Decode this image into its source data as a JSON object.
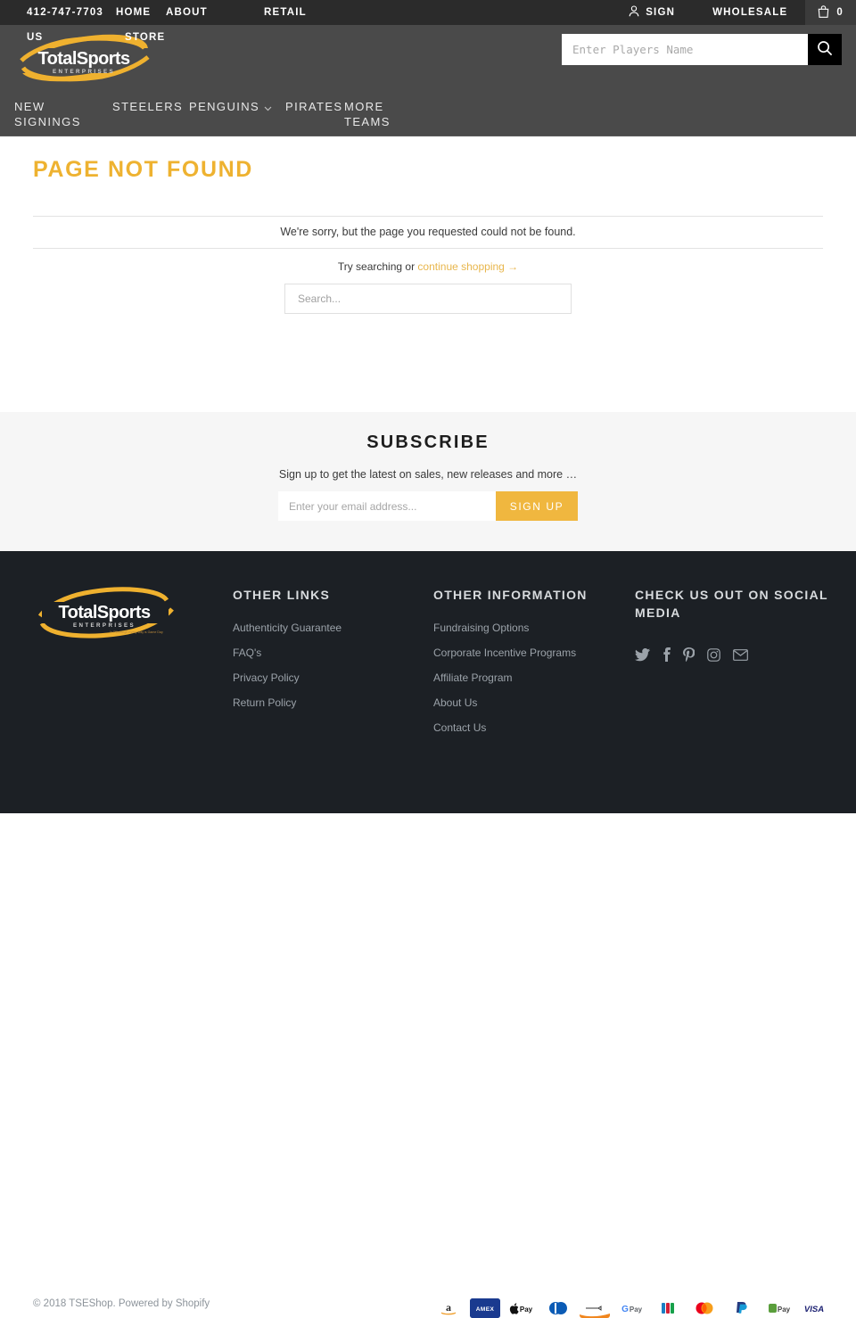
{
  "topbar": {
    "phone": "412-747-7703",
    "home": "HOME",
    "about": "ABOUT",
    "about2": "US",
    "retail": "RETAIL",
    "retail2": "STORE",
    "sign": "SIGN",
    "wholesale": "WHOLESALE",
    "cart_count": "0",
    "icons": {
      "person": "person-icon",
      "bag": "shopping-bag-icon"
    },
    "bg": "#2b2b2b"
  },
  "header": {
    "logo_main": "TotalSports",
    "logo_sub": "E N T E R P R I S E S",
    "search_placeholder": "Enter Players Name",
    "search_value": "",
    "search_icon": "search-icon",
    "bg": "#4a4a4a",
    "accent": "#eeb230"
  },
  "mainnav": {
    "items": [
      {
        "label": "NEW SIGNINGS",
        "has_chevron": false
      },
      {
        "label": "STEELERS",
        "has_chevron": false
      },
      {
        "label": "PENGUINS",
        "has_chevron": true
      },
      {
        "label": "PIRATES",
        "has_chevron": false
      },
      {
        "label": "MORE TEAMS",
        "has_chevron": false
      }
    ]
  },
  "main": {
    "title": "PAGE NOT FOUND",
    "message": "We're sorry, but the page you requested could not be found.",
    "try_text": "Try searching or ",
    "continue_link": "continue shopping →",
    "search_placeholder": "Search...",
    "search_value": "",
    "title_color": "#eeb230"
  },
  "subscribe": {
    "title": "SUBSCRIBE",
    "subtitle": "Sign up to get the latest on sales, new releases and more …",
    "email_placeholder": "Enter your email address...",
    "email_value": "",
    "button_label": "SIGN UP",
    "button_color": "#f0b73f",
    "bg": "#f6f6f6"
  },
  "footer": {
    "bg": "#1c2025",
    "logo_main": "TotalSports",
    "logo_sub": "E N T E R P R I S E S",
    "logo_tag": "In Pittsburgh Every Day is Game Day",
    "col1": {
      "heading": "OTHER LINKS",
      "links": [
        "Authenticity Guarantee",
        "FAQ's",
        "Privacy Policy",
        "Return Policy"
      ]
    },
    "col2": {
      "heading": "OTHER INFORMATION",
      "links": [
        "Fundraising Options",
        "Corporate Incentive Programs",
        "Affiliate Program",
        "About Us",
        "Contact Us"
      ]
    },
    "col3": {
      "heading": "CHECK US OUT ON SOCIAL MEDIA",
      "social": [
        "twitter-icon",
        "facebook-icon",
        "pinterest-icon",
        "instagram-icon",
        "email-icon"
      ]
    },
    "copyright_prefix": "© 2018 ",
    "copyright_shop": "TSEShop",
    "copyright_mid": ". Powered by ",
    "copyright_platform": "Shopify",
    "payments": [
      "amazon",
      "amex",
      "apple-pay",
      "diners-club",
      "discover",
      "google-pay",
      "jcb",
      "mastercard",
      "paypal",
      "shop-pay",
      "visa"
    ]
  }
}
